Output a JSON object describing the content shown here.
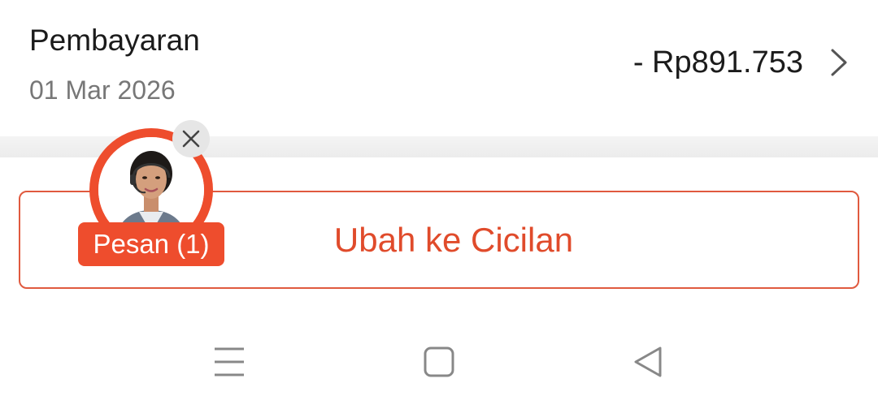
{
  "transaction": {
    "title": "Pembayaran",
    "date": "01 Mar 2026",
    "amount": "- Rp891.753",
    "detail_icon": "chevron-right-icon"
  },
  "installment_button": {
    "label": "Ubah ke Cicilan",
    "accent_color": "#e04b2b"
  },
  "chat_widget": {
    "badge_label": "Pesan (1)",
    "avatar_icon": "customer-service-agent-avatar",
    "close_icon": "close-icon",
    "brand_color": "#ee4d2d"
  },
  "system_nav": {
    "items": [
      "menu-icon",
      "home-icon",
      "back-icon"
    ]
  }
}
